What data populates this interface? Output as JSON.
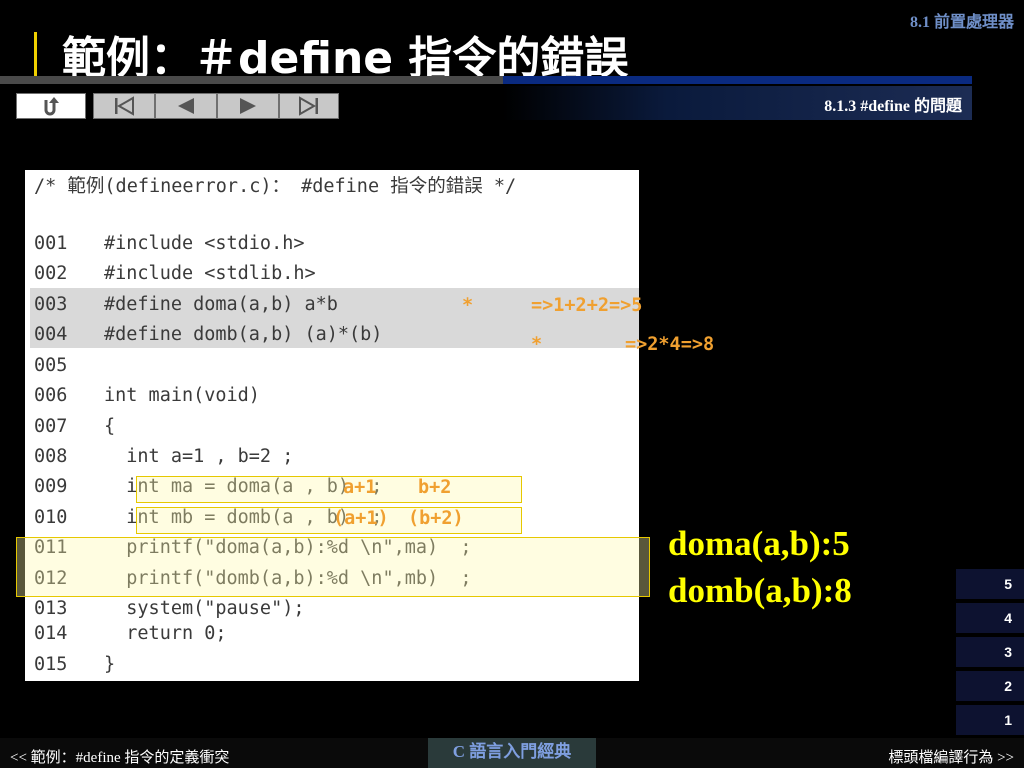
{
  "header": {
    "section": "8.1 前置處理器",
    "title": "範例：＃define 指令的錯誤",
    "subsection": "8.1.3 #define 的問題"
  },
  "nav": {
    "return_icon": "return-arrow-icon",
    "first_icon": "first-page-icon",
    "prev_icon": "prev-page-icon",
    "next_icon": "next-page-icon",
    "last_icon": "last-page-icon"
  },
  "code": {
    "comment": "/* 範例(defineerror.c)： #define 指令的錯誤 */",
    "lines": [
      {
        "num": "001",
        "text": "#include <stdio.h>"
      },
      {
        "num": "002",
        "text": "#include <stdlib.h>"
      },
      {
        "num": "003",
        "text": "#define doma(a,b) a*b"
      },
      {
        "num": "004",
        "text": "#define domb(a,b) (a)*(b)"
      },
      {
        "num": "005",
        "text": ""
      },
      {
        "num": "006",
        "text": "int main(void)"
      },
      {
        "num": "007",
        "text": "{"
      },
      {
        "num": "008",
        "text": "  int a=1 , b=2 ;"
      },
      {
        "num": "009",
        "text": "  int ma = doma(a , b)  ;"
      },
      {
        "num": "010",
        "text": "  int mb = domb(a , b)  ;"
      },
      {
        "num": "011",
        "text": "  printf(\"doma(a,b):%d \\n\",ma)  ;"
      },
      {
        "num": "012",
        "text": "  printf(\"domb(a,b):%d \\n\",mb)  ;"
      },
      {
        "num": "013",
        "text": "  system(\"pause\");"
      },
      {
        "num": "014",
        "text": "  return 0;"
      },
      {
        "num": "015",
        "text": "}"
      }
    ]
  },
  "annotations": {
    "star1": "*",
    "calc1": "=>1+2+2=>5",
    "star2": "*",
    "calc2": "=>2*4=>8",
    "ma_a": "a+1",
    "ma_b": "b+2",
    "mb_a": "(a+1)",
    "mb_b": "(b+2)"
  },
  "results": {
    "doma": "doma(a,b):5",
    "domb": "domb(a,b):8"
  },
  "pages": [
    "5",
    "4",
    "3",
    "2",
    "1"
  ],
  "footer": {
    "prev": "<< 範例：#define 指令的定義衝突",
    "book": "C 語言入門經典",
    "next": "標頭檔編譯行為 >>"
  },
  "colors": {
    "accent_yellow": "#ffff00",
    "annotation_orange": "#f0a030",
    "title_bar": "#f0d000"
  }
}
